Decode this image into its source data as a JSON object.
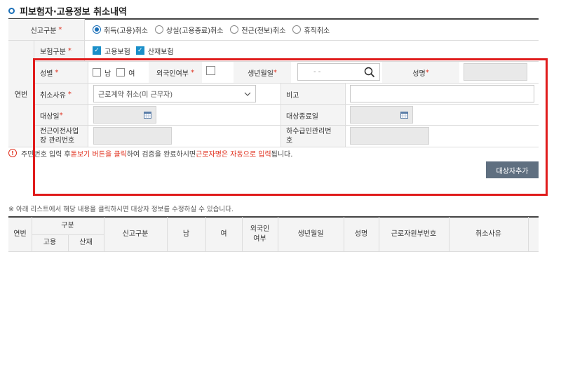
{
  "page_title": "피보험자·고용정보 취소내역",
  "form": {
    "report_type_label": "신고구분",
    "report_types": [
      "취득(고용)취소",
      "상실(고용종료)취소",
      "전근(전보)취소",
      "휴직취소"
    ],
    "row_no_label": "연번",
    "insurance_label": "보험구분",
    "insurance_options": [
      "고용보험",
      "산재보험"
    ],
    "gender_label": "성별",
    "gender_options": [
      "남",
      "여"
    ],
    "foreigner_label": "외국인여부",
    "birth_label": "생년월일",
    "birth_placeholder": "- -",
    "name_label": "성명",
    "cancel_reason_label": "취소사유",
    "cancel_reason_value": "근로계약 취소(미 근무자)",
    "remarks_label": "비고",
    "target_date_label": "대상일",
    "target_end_date_label": "대상종료일",
    "prev_workplace_label_1": "전근이전사업",
    "prev_workplace_label_2": "장 관리번호",
    "subcontract_label_1": "하수급인관리번",
    "subcontract_label_2": "호",
    "required_mark": "*"
  },
  "notice": {
    "icon": "warning-icon",
    "icon_glyph": "!",
    "part1": "주민번호 입력 후 ",
    "part2": "돋보기 버튼을 클릭",
    "part3": "하여 검증을 완료하시면 ",
    "part4": "근로자명은 자동으로 입력",
    "part5": "됩니다."
  },
  "add_button_label": "대상자추가",
  "list_note": "※ 아래 리스트에서 해당 내용을 클릭하시면 대상자 정보를 수정하실 수 있습니다.",
  "table": {
    "headers": {
      "no": "연번",
      "category": "구분",
      "employment": "고용",
      "accident": "산재",
      "report_type": "신고구분",
      "male": "남",
      "female": "여",
      "foreigner_1": "외국인",
      "foreigner_2": "여부",
      "birth": "생년월일",
      "name": "성명",
      "worker_no": "근로자원부번호",
      "cancel_reason": "취소사유"
    }
  },
  "colors": {
    "accent": "#1a6fb8",
    "required": "#e0301e",
    "highlight_box": "#e01b1b",
    "button": "#5f6f80"
  }
}
